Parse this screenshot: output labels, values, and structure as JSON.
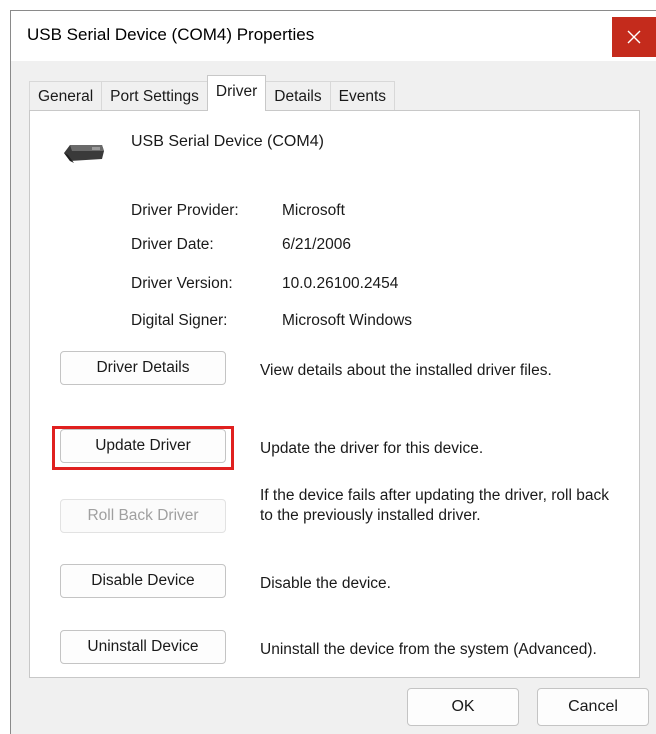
{
  "window": {
    "title": "USB Serial Device (COM4) Properties",
    "close_icon": "close-icon",
    "close_color": "#c42b1c"
  },
  "tabs": [
    {
      "label": "General",
      "active": false
    },
    {
      "label": "Port Settings",
      "active": false
    },
    {
      "label": "Driver",
      "active": true
    },
    {
      "label": "Details",
      "active": false
    },
    {
      "label": "Events",
      "active": false
    }
  ],
  "device": {
    "icon": "usb-connector-icon",
    "name": "USB Serial Device (COM4)"
  },
  "properties": [
    {
      "label": "Driver Provider:",
      "value": "Microsoft"
    },
    {
      "label": "Driver Date:",
      "value": "6/21/2006"
    },
    {
      "label": "Driver Version:",
      "value": "10.0.26100.2454"
    },
    {
      "label": "Digital Signer:",
      "value": "Microsoft Windows"
    }
  ],
  "actions": [
    {
      "button": "Driver Details",
      "description": "View details about the installed driver files.",
      "enabled": true
    },
    {
      "button": "Update Driver",
      "description": "Update the driver for this device.",
      "enabled": true,
      "highlighted": true
    },
    {
      "button": "Roll Back Driver",
      "description": "If the device fails after updating the driver, roll back to the previously installed driver.",
      "enabled": false
    },
    {
      "button": "Disable Device",
      "description": "Disable the device.",
      "enabled": true
    },
    {
      "button": "Uninstall Device",
      "description": "Uninstall the device from the system (Advanced).",
      "enabled": true
    }
  ],
  "footer": {
    "ok_label": "OK",
    "cancel_label": "Cancel"
  },
  "colors": {
    "highlight": "#e0201f"
  }
}
